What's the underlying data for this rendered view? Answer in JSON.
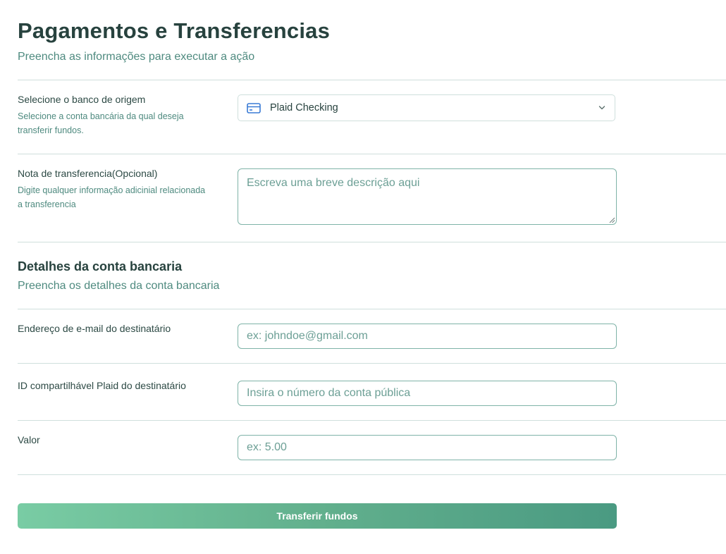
{
  "header": {
    "title": "Pagamentos e Transferencias",
    "subtitle": "Preencha as informações para executar a ação"
  },
  "source_bank": {
    "label": "Selecione o banco de origem",
    "help": "Selecione a conta bancária da qual deseja transferir fundos.",
    "selected_value": "Plaid Checking",
    "icon": "credit-card-icon"
  },
  "note": {
    "label": "Nota de transferencia(Opcional)",
    "help": "Digite qualquer informação adicinial relacionada a transferencia",
    "placeholder": "Escreva uma breve descrição aqui"
  },
  "bank_details": {
    "title": "Detalhes da conta bancaria",
    "subtitle": "Preencha os detalhes da conta bancaria"
  },
  "recipient_email": {
    "label": "Endereço de e-mail do destinatário",
    "placeholder": "ex: johndoe@gmail.com"
  },
  "recipient_plaid_id": {
    "label": "ID compartilhável Plaid do destinatário",
    "placeholder": "Insira o número da conta pública"
  },
  "amount": {
    "label": "Valor",
    "placeholder": "ex: 5.00"
  },
  "submit": {
    "label": "Transferir fundos"
  },
  "colors": {
    "accent_start": "#79cca4",
    "accent_end": "#4a9a82",
    "icon_blue": "#3a7bd5"
  }
}
